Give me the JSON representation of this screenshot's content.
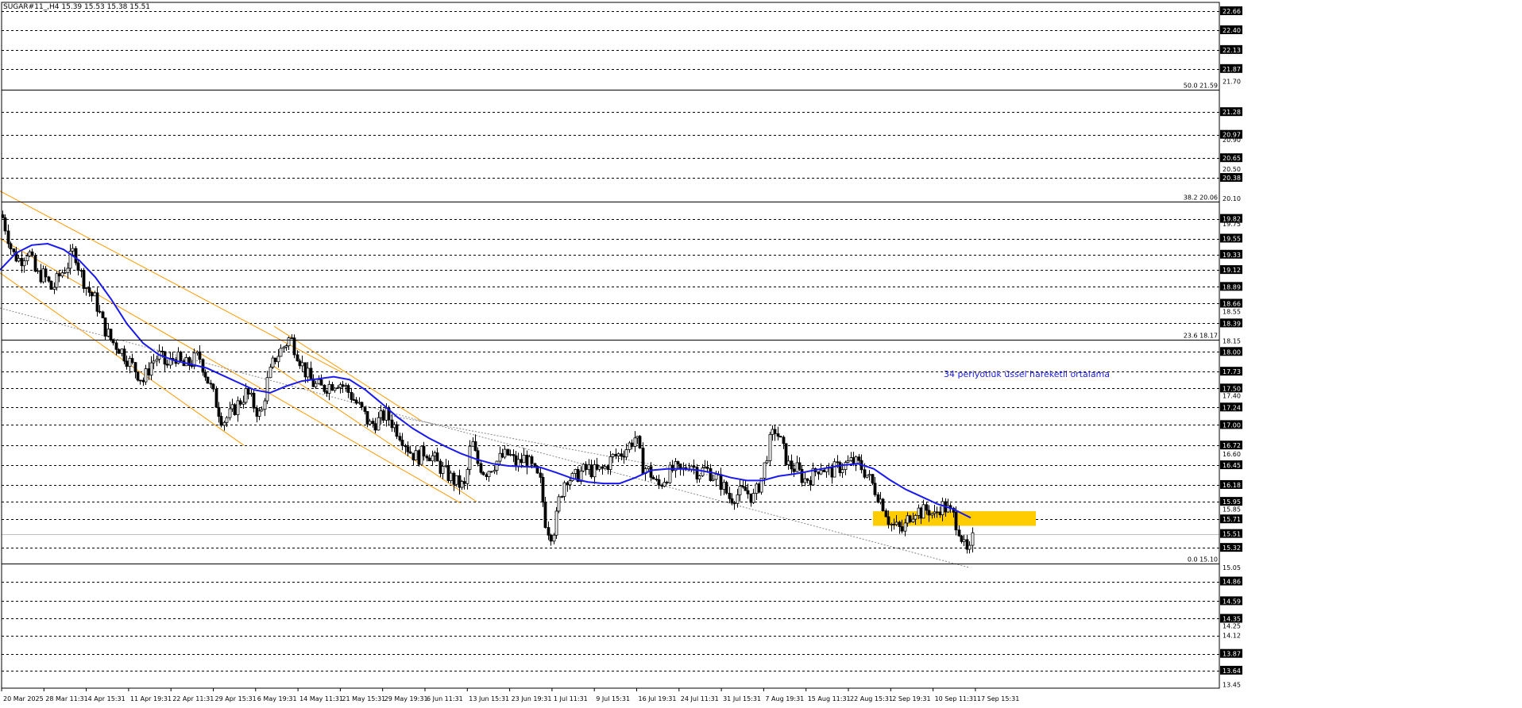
{
  "header": {
    "symbol": "SUGAR#11_,H4",
    "ohlc": "15.39 15.53 15.38 15.51"
  },
  "chart_data": {
    "type": "candlestick",
    "symbol": "SUGAR#11_",
    "timeframe": "H4",
    "ylim": [
      13.4,
      22.78
    ],
    "price_scale_ticks": [
      "22.66",
      "22.40",
      "22.13",
      "21.87",
      "21.70",
      "21.28",
      "20.97",
      "20.90",
      "20.65",
      "20.50",
      "20.38",
      "20.10",
      "19.82",
      "19.75",
      "19.55",
      "19.33",
      "19.12",
      "18.89",
      "18.66",
      "18.55",
      "18.39",
      "18.15",
      "18.00",
      "17.73",
      "17.50",
      "17.40",
      "17.24",
      "17.00",
      "16.72",
      "16.60",
      "16.45",
      "16.18",
      "15.95",
      "15.85",
      "15.71",
      "15.51",
      "15.32",
      "15.05",
      "14.86",
      "14.59",
      "14.35",
      "14.12",
      "14.25",
      "13.87",
      "13.64",
      "13.45"
    ],
    "highlighted_levels": [
      "22.66",
      "22.40",
      "22.13",
      "21.87",
      "21.28",
      "20.97",
      "20.65",
      "20.38",
      "19.82",
      "19.55",
      "19.33",
      "19.12",
      "18.89",
      "18.66",
      "18.39",
      "18.00",
      "17.73",
      "17.50",
      "17.24",
      "17.00",
      "16.72",
      "16.45",
      "16.18",
      "15.95",
      "15.71",
      "15.51",
      "15.32",
      "14.86",
      "14.59",
      "14.35",
      "13.87",
      "13.64"
    ],
    "horizontal_lines": [
      22.66,
      22.4,
      22.13,
      21.87,
      21.28,
      20.97,
      20.65,
      20.38,
      19.82,
      19.55,
      19.33,
      19.12,
      18.89,
      18.66,
      18.39,
      18.0,
      17.73,
      17.5,
      17.24,
      17.0,
      16.72,
      16.45,
      16.18,
      15.95,
      15.71,
      15.32,
      14.86,
      14.59,
      14.35,
      14.12,
      13.87,
      13.64
    ],
    "fibonacci": [
      {
        "label": "50.0 21.59",
        "value": 21.59
      },
      {
        "label": "38.2 20.06",
        "value": 20.06
      },
      {
        "label": "23.6 18.17",
        "value": 18.17
      },
      {
        "label": "0.0 15.10",
        "value": 15.1
      }
    ],
    "current_price": 15.51,
    "x_tick_labels": [
      "20 Mar 2025",
      "28 Mar 11:31",
      "4 Apr 15:31",
      "11 Apr 19:31",
      "22 Apr 11:31",
      "29 Apr 15:31",
      "6 May 19:31",
      "14 May 11:31",
      "21 May 15:31",
      "29 May 19:31",
      "6 Jun 11:31",
      "13 Jun 15:31",
      "23 Jun 19:31",
      "1 Jul 11:31",
      "9 Jul 15:31",
      "16 Jul 19:31",
      "24 Jul 11:31",
      "31 Jul 15:31",
      "7 Aug 19:31",
      "15 Aug 11:31",
      "22 Aug 15:31",
      "2 Sep 19:31",
      "10 Sep 11:31",
      "17 Sep 15:31"
    ],
    "price_path": [
      [
        0,
        19.95
      ],
      [
        8,
        19.65
      ],
      [
        15,
        19.35
      ],
      [
        25,
        19.25
      ],
      [
        35,
        19.4
      ],
      [
        45,
        19.05
      ],
      [
        55,
        19.05
      ],
      [
        65,
        18.85
      ],
      [
        75,
        19.05
      ],
      [
        85,
        19.2
      ],
      [
        93,
        19.4
      ],
      [
        100,
        19.1
      ],
      [
        110,
        18.85
      ],
      [
        120,
        18.7
      ],
      [
        130,
        18.35
      ],
      [
        140,
        18.15
      ],
      [
        150,
        18.05
      ],
      [
        160,
        17.9
      ],
      [
        170,
        17.75
      ],
      [
        180,
        17.6
      ],
      [
        190,
        17.85
      ],
      [
        200,
        17.95
      ],
      [
        210,
        17.8
      ],
      [
        220,
        17.95
      ],
      [
        230,
        17.8
      ],
      [
        240,
        17.85
      ],
      [
        250,
        17.95
      ],
      [
        260,
        17.65
      ],
      [
        270,
        17.35
      ],
      [
        280,
        17.05
      ],
      [
        290,
        17.15
      ],
      [
        300,
        17.3
      ],
      [
        310,
        17.45
      ],
      [
        320,
        17.25
      ],
      [
        328,
        17.1
      ],
      [
        335,
        17.55
      ],
      [
        345,
        17.9
      ],
      [
        355,
        18.05
      ],
      [
        365,
        18.2
      ],
      [
        375,
        17.95
      ],
      [
        385,
        17.7
      ],
      [
        395,
        17.55
      ],
      [
        405,
        17.5
      ],
      [
        415,
        17.55
      ],
      [
        425,
        17.6
      ],
      [
        435,
        17.5
      ],
      [
        445,
        17.35
      ],
      [
        455,
        17.2
      ],
      [
        465,
        17.0
      ],
      [
        475,
        17.05
      ],
      [
        485,
        17.15
      ],
      [
        495,
        17.0
      ],
      [
        505,
        16.85
      ],
      [
        515,
        16.65
      ],
      [
        525,
        16.55
      ],
      [
        535,
        16.65
      ],
      [
        545,
        16.55
      ],
      [
        555,
        16.4
      ],
      [
        565,
        16.3
      ],
      [
        575,
        16.2
      ],
      [
        585,
        16.15
      ],
      [
        593,
        16.8
      ],
      [
        600,
        16.5
      ],
      [
        610,
        16.35
      ],
      [
        620,
        16.45
      ],
      [
        630,
        16.55
      ],
      [
        640,
        16.6
      ],
      [
        650,
        16.45
      ],
      [
        660,
        16.55
      ],
      [
        670,
        16.4
      ],
      [
        680,
        16.2
      ],
      [
        686,
        15.7
      ],
      [
        692,
        15.5
      ],
      [
        698,
        15.6
      ],
      [
        704,
        16.0
      ],
      [
        712,
        16.3
      ],
      [
        720,
        16.25
      ],
      [
        730,
        16.35
      ],
      [
        740,
        16.4
      ],
      [
        750,
        16.35
      ],
      [
        760,
        16.4
      ],
      [
        770,
        16.55
      ],
      [
        780,
        16.6
      ],
      [
        790,
        16.7
      ],
      [
        800,
        16.85
      ],
      [
        808,
        16.45
      ],
      [
        818,
        16.35
      ],
      [
        828,
        16.15
      ],
      [
        838,
        16.3
      ],
      [
        848,
        16.4
      ],
      [
        858,
        16.35
      ],
      [
        868,
        16.5
      ],
      [
        878,
        16.35
      ],
      [
        888,
        16.4
      ],
      [
        898,
        16.3
      ],
      [
        908,
        16.2
      ],
      [
        918,
        16.0
      ],
      [
        928,
        16.05
      ],
      [
        938,
        16.1
      ],
      [
        948,
        16.0
      ],
      [
        958,
        16.25
      ],
      [
        968,
        16.75
      ],
      [
        976,
        16.95
      ],
      [
        984,
        16.7
      ],
      [
        992,
        16.45
      ],
      [
        1002,
        16.4
      ],
      [
        1012,
        16.25
      ],
      [
        1022,
        16.3
      ],
      [
        1032,
        16.45
      ],
      [
        1042,
        16.35
      ],
      [
        1052,
        16.4
      ],
      [
        1062,
        16.45
      ],
      [
        1072,
        16.5
      ],
      [
        1082,
        16.45
      ],
      [
        1092,
        16.3
      ],
      [
        1102,
        16.1
      ],
      [
        1112,
        15.9
      ],
      [
        1120,
        15.65
      ],
      [
        1128,
        15.6
      ],
      [
        1136,
        15.55
      ],
      [
        1144,
        15.75
      ],
      [
        1152,
        15.85
      ],
      [
        1160,
        15.8
      ],
      [
        1168,
        15.85
      ],
      [
        1176,
        15.75
      ],
      [
        1184,
        15.9
      ],
      [
        1192,
        15.85
      ],
      [
        1200,
        15.75
      ],
      [
        1208,
        15.55
      ],
      [
        1214,
        15.3
      ],
      [
        1219,
        15.2
      ],
      [
        1224,
        15.45
      ]
    ],
    "ema_label": "34 periyotluk üssel hareketli ortalama",
    "ema_period": 34,
    "ema_path": [
      [
        0,
        19.12
      ],
      [
        20,
        19.35
      ],
      [
        40,
        19.46
      ],
      [
        60,
        19.48
      ],
      [
        80,
        19.4
      ],
      [
        100,
        19.25
      ],
      [
        120,
        19.02
      ],
      [
        140,
        18.72
      ],
      [
        160,
        18.38
      ],
      [
        180,
        18.12
      ],
      [
        200,
        17.96
      ],
      [
        220,
        17.88
      ],
      [
        240,
        17.83
      ],
      [
        260,
        17.78
      ],
      [
        280,
        17.68
      ],
      [
        300,
        17.58
      ],
      [
        320,
        17.48
      ],
      [
        340,
        17.44
      ],
      [
        360,
        17.53
      ],
      [
        380,
        17.6
      ],
      [
        400,
        17.63
      ],
      [
        420,
        17.66
      ],
      [
        440,
        17.62
      ],
      [
        460,
        17.48
      ],
      [
        480,
        17.3
      ],
      [
        500,
        17.11
      ],
      [
        520,
        16.95
      ],
      [
        540,
        16.82
      ],
      [
        560,
        16.71
      ],
      [
        580,
        16.61
      ],
      [
        600,
        16.53
      ],
      [
        620,
        16.47
      ],
      [
        640,
        16.44
      ],
      [
        660,
        16.43
      ],
      [
        680,
        16.42
      ],
      [
        700,
        16.35
      ],
      [
        720,
        16.27
      ],
      [
        740,
        16.22
      ],
      [
        760,
        16.2
      ],
      [
        780,
        16.2
      ],
      [
        800,
        16.28
      ],
      [
        820,
        16.38
      ],
      [
        840,
        16.4
      ],
      [
        860,
        16.4
      ],
      [
        880,
        16.38
      ],
      [
        900,
        16.34
      ],
      [
        920,
        16.28
      ],
      [
        940,
        16.24
      ],
      [
        960,
        16.24
      ],
      [
        980,
        16.3
      ],
      [
        1000,
        16.33
      ],
      [
        1020,
        16.37
      ],
      [
        1040,
        16.41
      ],
      [
        1060,
        16.45
      ],
      [
        1080,
        16.47
      ],
      [
        1100,
        16.4
      ],
      [
        1120,
        16.25
      ],
      [
        1140,
        16.12
      ],
      [
        1160,
        16.02
      ],
      [
        1180,
        15.92
      ],
      [
        1200,
        15.85
      ],
      [
        1222,
        15.73
      ]
    ],
    "channels": [
      {
        "color": "#ff9900",
        "lines": [
          [
            [
              0,
              20.2
            ],
            [
              430,
              17.72
            ]
          ],
          [
            [
              0,
              19.55
            ],
            [
              580,
              15.93
            ]
          ],
          [
            [
              0,
              19.08
            ],
            [
              307,
              16.72
            ]
          ]
        ]
      },
      {
        "color": "#ff9900",
        "lines": [
          [
            [
              345,
              18.35
            ],
            [
              530,
              17.06
            ]
          ],
          [
            [
              345,
              17.8
            ],
            [
              600,
              15.95
            ]
          ]
        ]
      }
    ],
    "trendlines": [
      {
        "type": "dotted",
        "points": [
          [
            0,
            18.6
          ],
          [
            1220,
            15.05
          ]
        ]
      },
      {
        "type": "dotted",
        "points": [
          [
            480,
            17.15
          ],
          [
            900,
            16.3
          ]
        ]
      }
    ],
    "zones": [
      {
        "color": "#ffcc00",
        "from_price": 15.62,
        "to_price": 15.82,
        "x_from": 1099,
        "x_to": 1304
      }
    ]
  }
}
